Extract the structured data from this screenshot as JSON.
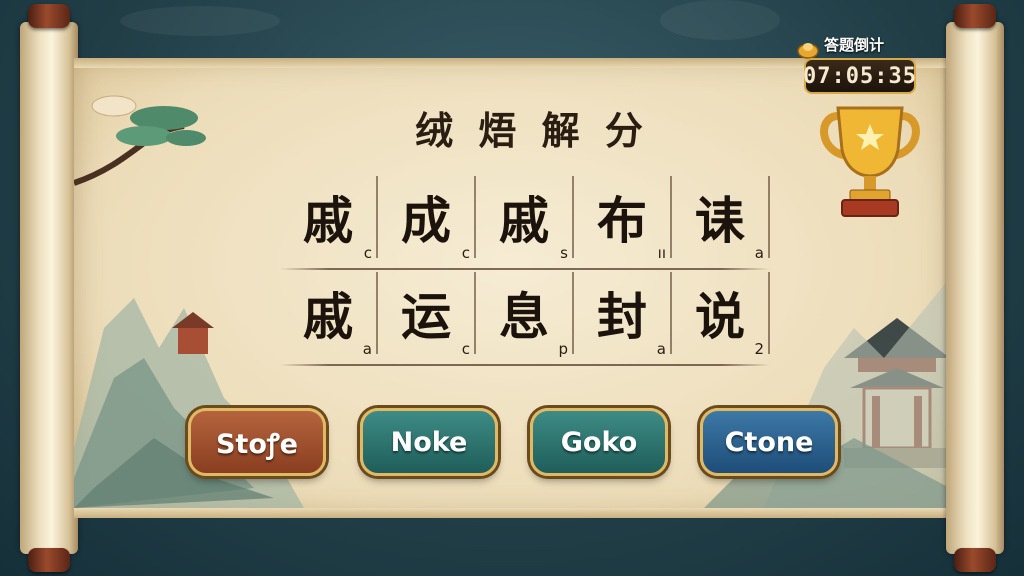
{
  "timer": {
    "label": "答题倒计",
    "value": "07:05:35"
  },
  "title": "绒 焐 解 分",
  "rows": [
    [
      {
        "char": "戚",
        "sub": "c"
      },
      {
        "char": "成",
        "sub": "c"
      },
      {
        "char": "戚",
        "sub": "s"
      },
      {
        "char": "布",
        "sub": "ıı"
      },
      {
        "char": "诔",
        "sub": "a"
      }
    ],
    [
      {
        "char": "戚",
        "sub": "a"
      },
      {
        "char": "运",
        "sub": "c"
      },
      {
        "char": "息",
        "sub": "p"
      },
      {
        "char": "封",
        "sub": "a"
      },
      {
        "char": "说",
        "sub": "2"
      }
    ]
  ],
  "answers": [
    "Stoꝭe",
    "Noke",
    "Goko",
    "Ctone"
  ],
  "colors": {
    "answer1": "#8a3e20",
    "answer2": "#1f5e5a",
    "answer3": "#1f5e5a",
    "answer4": "#1e4d78",
    "gold": "#d7a846"
  },
  "icons": {
    "timer": "gold-nugget-icon",
    "trophy": "trophy-icon"
  }
}
